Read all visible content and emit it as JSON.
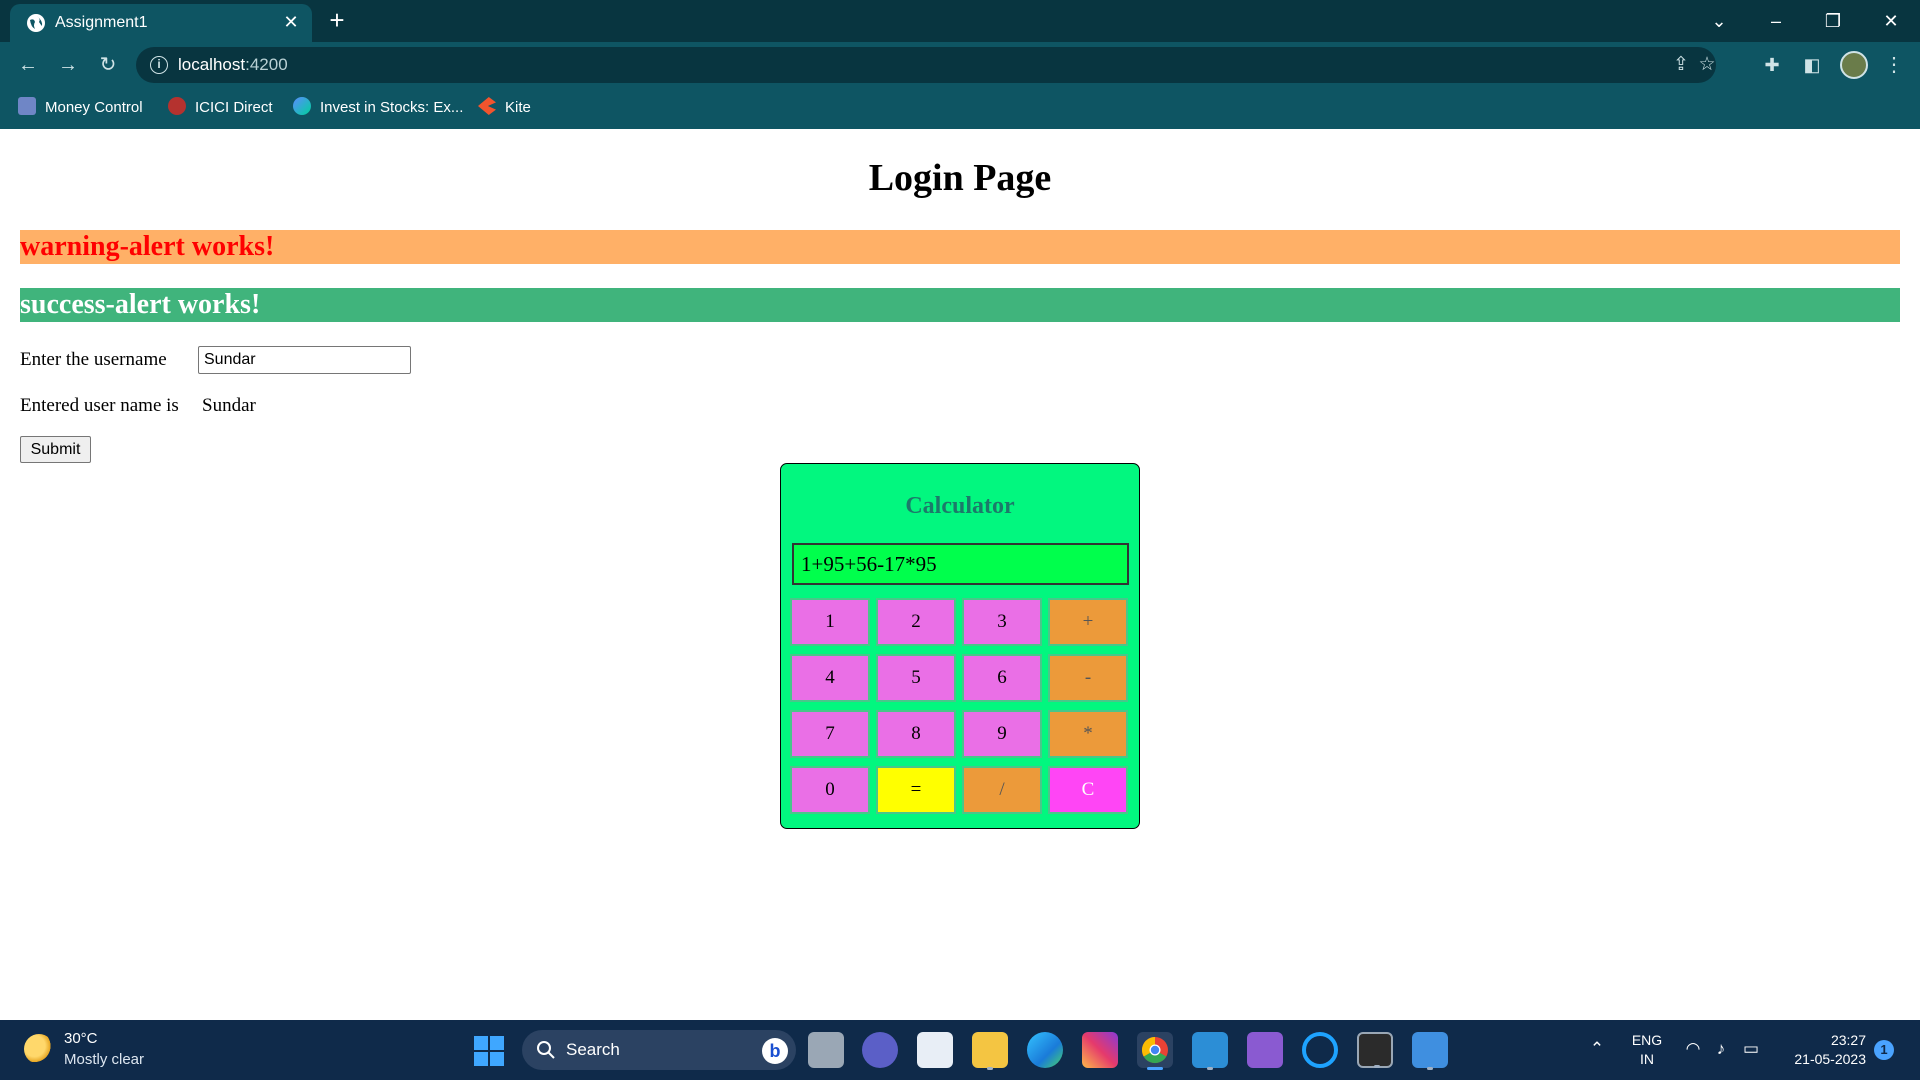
{
  "browser": {
    "tab_title": "Assignment1",
    "url_host": "localhost",
    "url_port": ":4200",
    "bookmarks": [
      {
        "label": "Money Control",
        "icon": "moneycontrol-icon"
      },
      {
        "label": "ICICI Direct",
        "icon": "icici-icon"
      },
      {
        "label": "Invest in Stocks: Ex...",
        "icon": "groww-icon"
      },
      {
        "label": "Kite",
        "icon": "kite-icon"
      }
    ]
  },
  "page": {
    "title": "Login Page",
    "warning_alert": "warning-alert works!",
    "success_alert": "success-alert works!",
    "username_label": "Enter the username",
    "username_value": "Sundar",
    "entered_label": "Entered user name is",
    "entered_value": "Sundar",
    "submit_label": "Submit"
  },
  "calculator": {
    "title": "Calculator",
    "display": "1+95+56-17*95",
    "keys": [
      "1",
      "2",
      "3",
      "+",
      "4",
      "5",
      "6",
      "-",
      "7",
      "8",
      "9",
      "*",
      "0",
      "=",
      "/",
      "C"
    ]
  },
  "taskbar": {
    "weather_temp": "30°C",
    "weather_desc": "Mostly clear",
    "search_label": "Search",
    "lang_top": "ENG",
    "lang_bottom": "IN",
    "time": "23:27",
    "date": "21-05-2023",
    "notification_count": "1"
  },
  "colors": {
    "warning_bg": "#ffb067",
    "warning_text": "#ff0000",
    "success_bg": "#40b47c",
    "calc_bg": "#02f77f",
    "calc_display_bg": "#00ff4c",
    "number_key": "#ea6fe6",
    "operator_key": "#ec9a3a",
    "equals_key": "#ffff00",
    "clear_key": "#ff45f5"
  }
}
